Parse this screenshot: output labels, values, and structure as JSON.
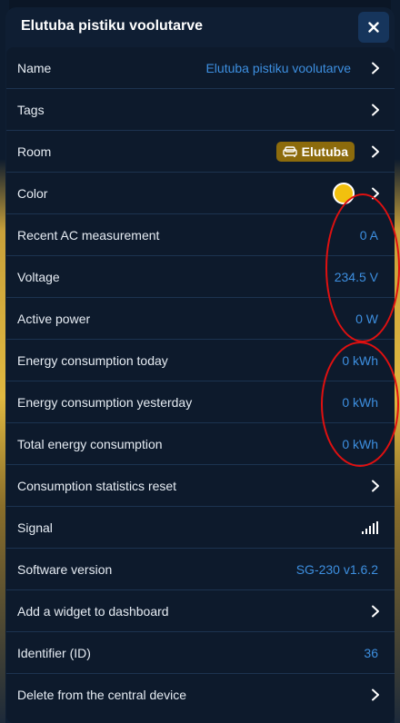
{
  "header": {
    "title": "Elutuba pistiku voolutarve",
    "close_icon": "close-icon"
  },
  "rows": [
    {
      "label": "Name",
      "value": "Elutuba pistiku voolutarve",
      "chevron": true
    },
    {
      "label": "Tags",
      "chevron": true
    },
    {
      "label": "Room",
      "badge": "Elutuba",
      "badge_icon": "sofa-icon",
      "badge_color": "#8c6b0c",
      "chevron": true
    },
    {
      "label": "Color",
      "color_swatch": "#f2c00e",
      "chevron": true
    },
    {
      "label": "Recent AC measurement",
      "value": "0 A"
    },
    {
      "label": "Voltage",
      "value": "234.5 V"
    },
    {
      "label": "Active power",
      "value": "0 W"
    },
    {
      "label": "Energy consumption today",
      "value": "0 kWh"
    },
    {
      "label": "Energy consumption yesterday",
      "value": "0 kWh"
    },
    {
      "label": "Total energy consumption",
      "value": "0 kWh"
    },
    {
      "label": "Consumption statistics reset",
      "chevron": true
    },
    {
      "label": "Signal",
      "signal_icon": "signal-bars-icon"
    },
    {
      "label": "Software version",
      "value": "SG-230 v1.6.2"
    },
    {
      "label": "Add a widget to dashboard",
      "chevron": true
    },
    {
      "label": "Identifier (ID)",
      "value": "36"
    },
    {
      "label": "Delete from the central device",
      "chevron": true
    }
  ],
  "colors": {
    "value_text": "#3d8fe0",
    "annotation": "#e01010",
    "background": "#0d1a2c"
  }
}
